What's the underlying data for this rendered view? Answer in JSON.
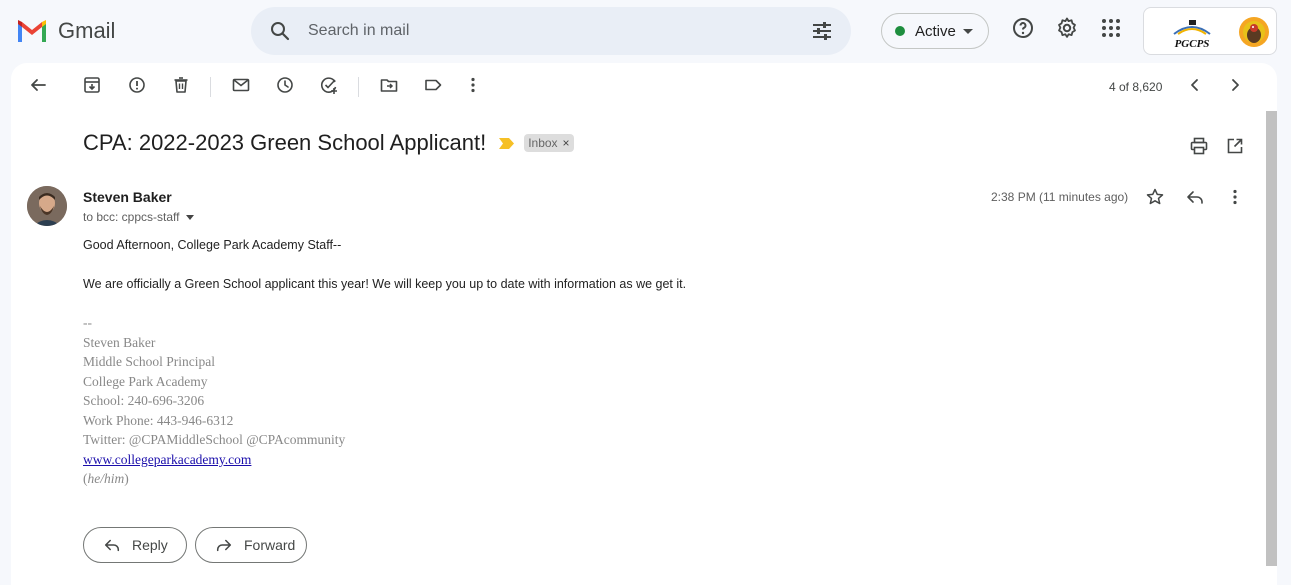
{
  "app": {
    "name": "Gmail"
  },
  "search": {
    "placeholder": "Search in mail"
  },
  "status": {
    "label": "Active",
    "color": "#1e8e3e"
  },
  "header_icons": [
    "help-icon",
    "settings-icon",
    "apps-grid-icon"
  ],
  "org": {
    "logo_text": "PGCPS"
  },
  "toolbar": {
    "icons": [
      "back-arrow-icon",
      "archive-icon",
      "report-spam-icon",
      "delete-icon",
      "mark-unread-icon",
      "snooze-icon",
      "add-to-tasks-icon",
      "move-to-icon",
      "labels-icon",
      "more-vert-icon"
    ],
    "pager": "4 of 8,620"
  },
  "email": {
    "subject": "CPA: 2022-2023 Green School Applicant!",
    "label": "Inbox",
    "label_remove": "×",
    "sender_name": "Steven Baker",
    "recipients": "to bcc: cppcs-staff",
    "time": "2:38 PM (11 minutes ago)",
    "greeting": "Good Afternoon, College Park Academy Staff--",
    "body": "We are officially a Green School applicant this year! We will keep you up to date with information as we get it.",
    "signature": {
      "dashes": "--",
      "name": "Steven Baker",
      "title": "Middle School Principal",
      "org": "College Park Academy",
      "school_phone": "School: 240-696-3206",
      "work_phone": "Work Phone: 443-946-6312",
      "twitter": "Twitter: @CPAMiddleSchool @CPAcommunity",
      "website": "www.collegeparkacademy.com",
      "pronouns": "he/him",
      "pronouns_open": "(",
      "pronouns_close": ")"
    }
  },
  "actions": {
    "reply": "Reply",
    "forward": "Forward"
  }
}
